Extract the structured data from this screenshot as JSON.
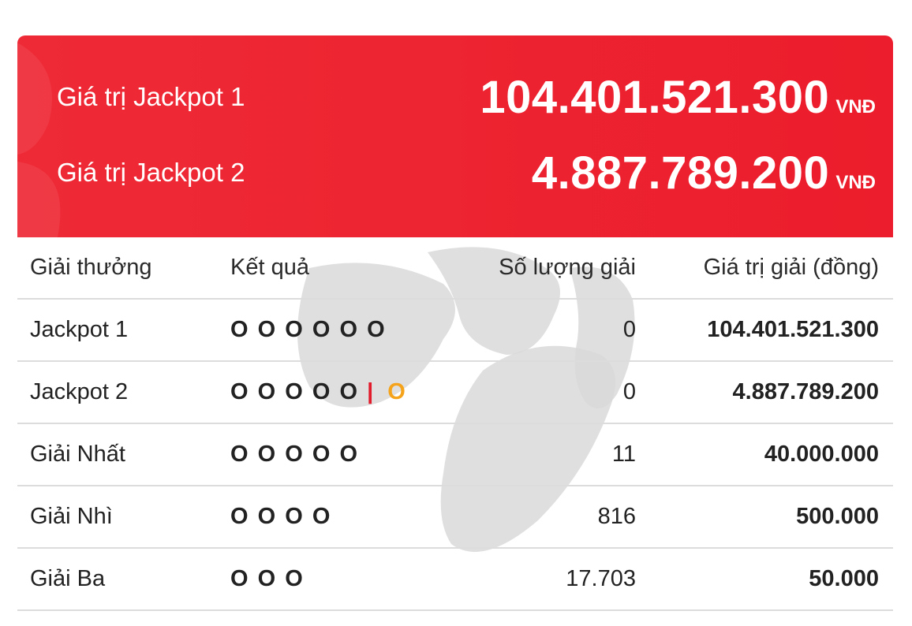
{
  "banner": {
    "jackpots": [
      {
        "label": "Giá trị Jackpot 1",
        "value": "104.401.521.300",
        "unit": "VNĐ"
      },
      {
        "label": "Giá trị Jackpot 2",
        "value": "4.887.789.200",
        "unit": "VNĐ"
      }
    ]
  },
  "table": {
    "headers": [
      "Giải thưởng",
      "Kết quả",
      "Số lượng giải",
      "Giá trị giải (đồng)"
    ],
    "rows": [
      {
        "name": "Jackpot 1",
        "match": "O O O O O O",
        "count": "0",
        "prize": "104.401.521.300"
      },
      {
        "name": "Jackpot 2",
        "match": "O O O O O",
        "special": "O",
        "count": "0",
        "prize": "4.887.789.200"
      },
      {
        "name": "Giải Nhất",
        "match": "O O O O O",
        "count": "11",
        "prize": "40.000.000"
      },
      {
        "name": "Giải Nhì",
        "match": "O O O O",
        "count": "816",
        "prize": "500.000"
      },
      {
        "name": "Giải Ba",
        "match": "O O O",
        "count": "17.703",
        "prize": "50.000"
      }
    ]
  },
  "colors": {
    "accent": "#ec1d2c",
    "special_ball": "#f5a31a"
  }
}
